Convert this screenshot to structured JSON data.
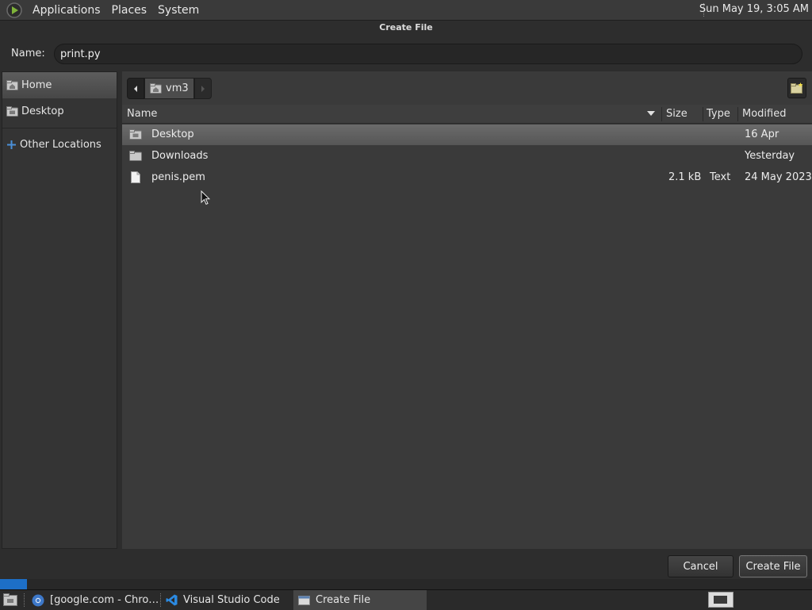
{
  "top_panel": {
    "menus": [
      "Applications",
      "Places",
      "System"
    ],
    "clock": "Sun May 19,  3:05 AM"
  },
  "dialog": {
    "title": "Create File",
    "name_label": "Name:",
    "name_value": "print.py",
    "sidebar": [
      {
        "label": "Home",
        "icon": "folder-home-icon",
        "selected": true
      },
      {
        "label": "Desktop",
        "icon": "folder-desktop-icon",
        "selected": false
      },
      {
        "label": "Other Locations",
        "icon": "plus-icon",
        "selected": false
      }
    ],
    "path": {
      "current": "vm3"
    },
    "columns": {
      "name": "Name",
      "size": "Size",
      "type": "Type",
      "modified": "Modified"
    },
    "files": [
      {
        "name": "Desktop",
        "size": "",
        "type": "",
        "modified": "16 Apr",
        "icon": "folder-icon",
        "selected": true
      },
      {
        "name": "Downloads",
        "size": "",
        "type": "",
        "modified": "Yesterday",
        "icon": "folder-icon",
        "selected": false
      },
      {
        "name": "penis.pem",
        "size": "2.1 kB",
        "type": "Text",
        "modified": "24 May 2023",
        "icon": "file-icon",
        "selected": false
      }
    ],
    "buttons": {
      "cancel": "Cancel",
      "create": "Create File"
    }
  },
  "taskbar": {
    "tasks": [
      {
        "label": "[google.com - Chro…",
        "icon": "chrome-icon",
        "active": false
      },
      {
        "label": "Visual Studio Code",
        "icon": "vscode-icon",
        "active": false
      },
      {
        "label": "Create File",
        "icon": "window-icon",
        "active": true
      }
    ]
  }
}
